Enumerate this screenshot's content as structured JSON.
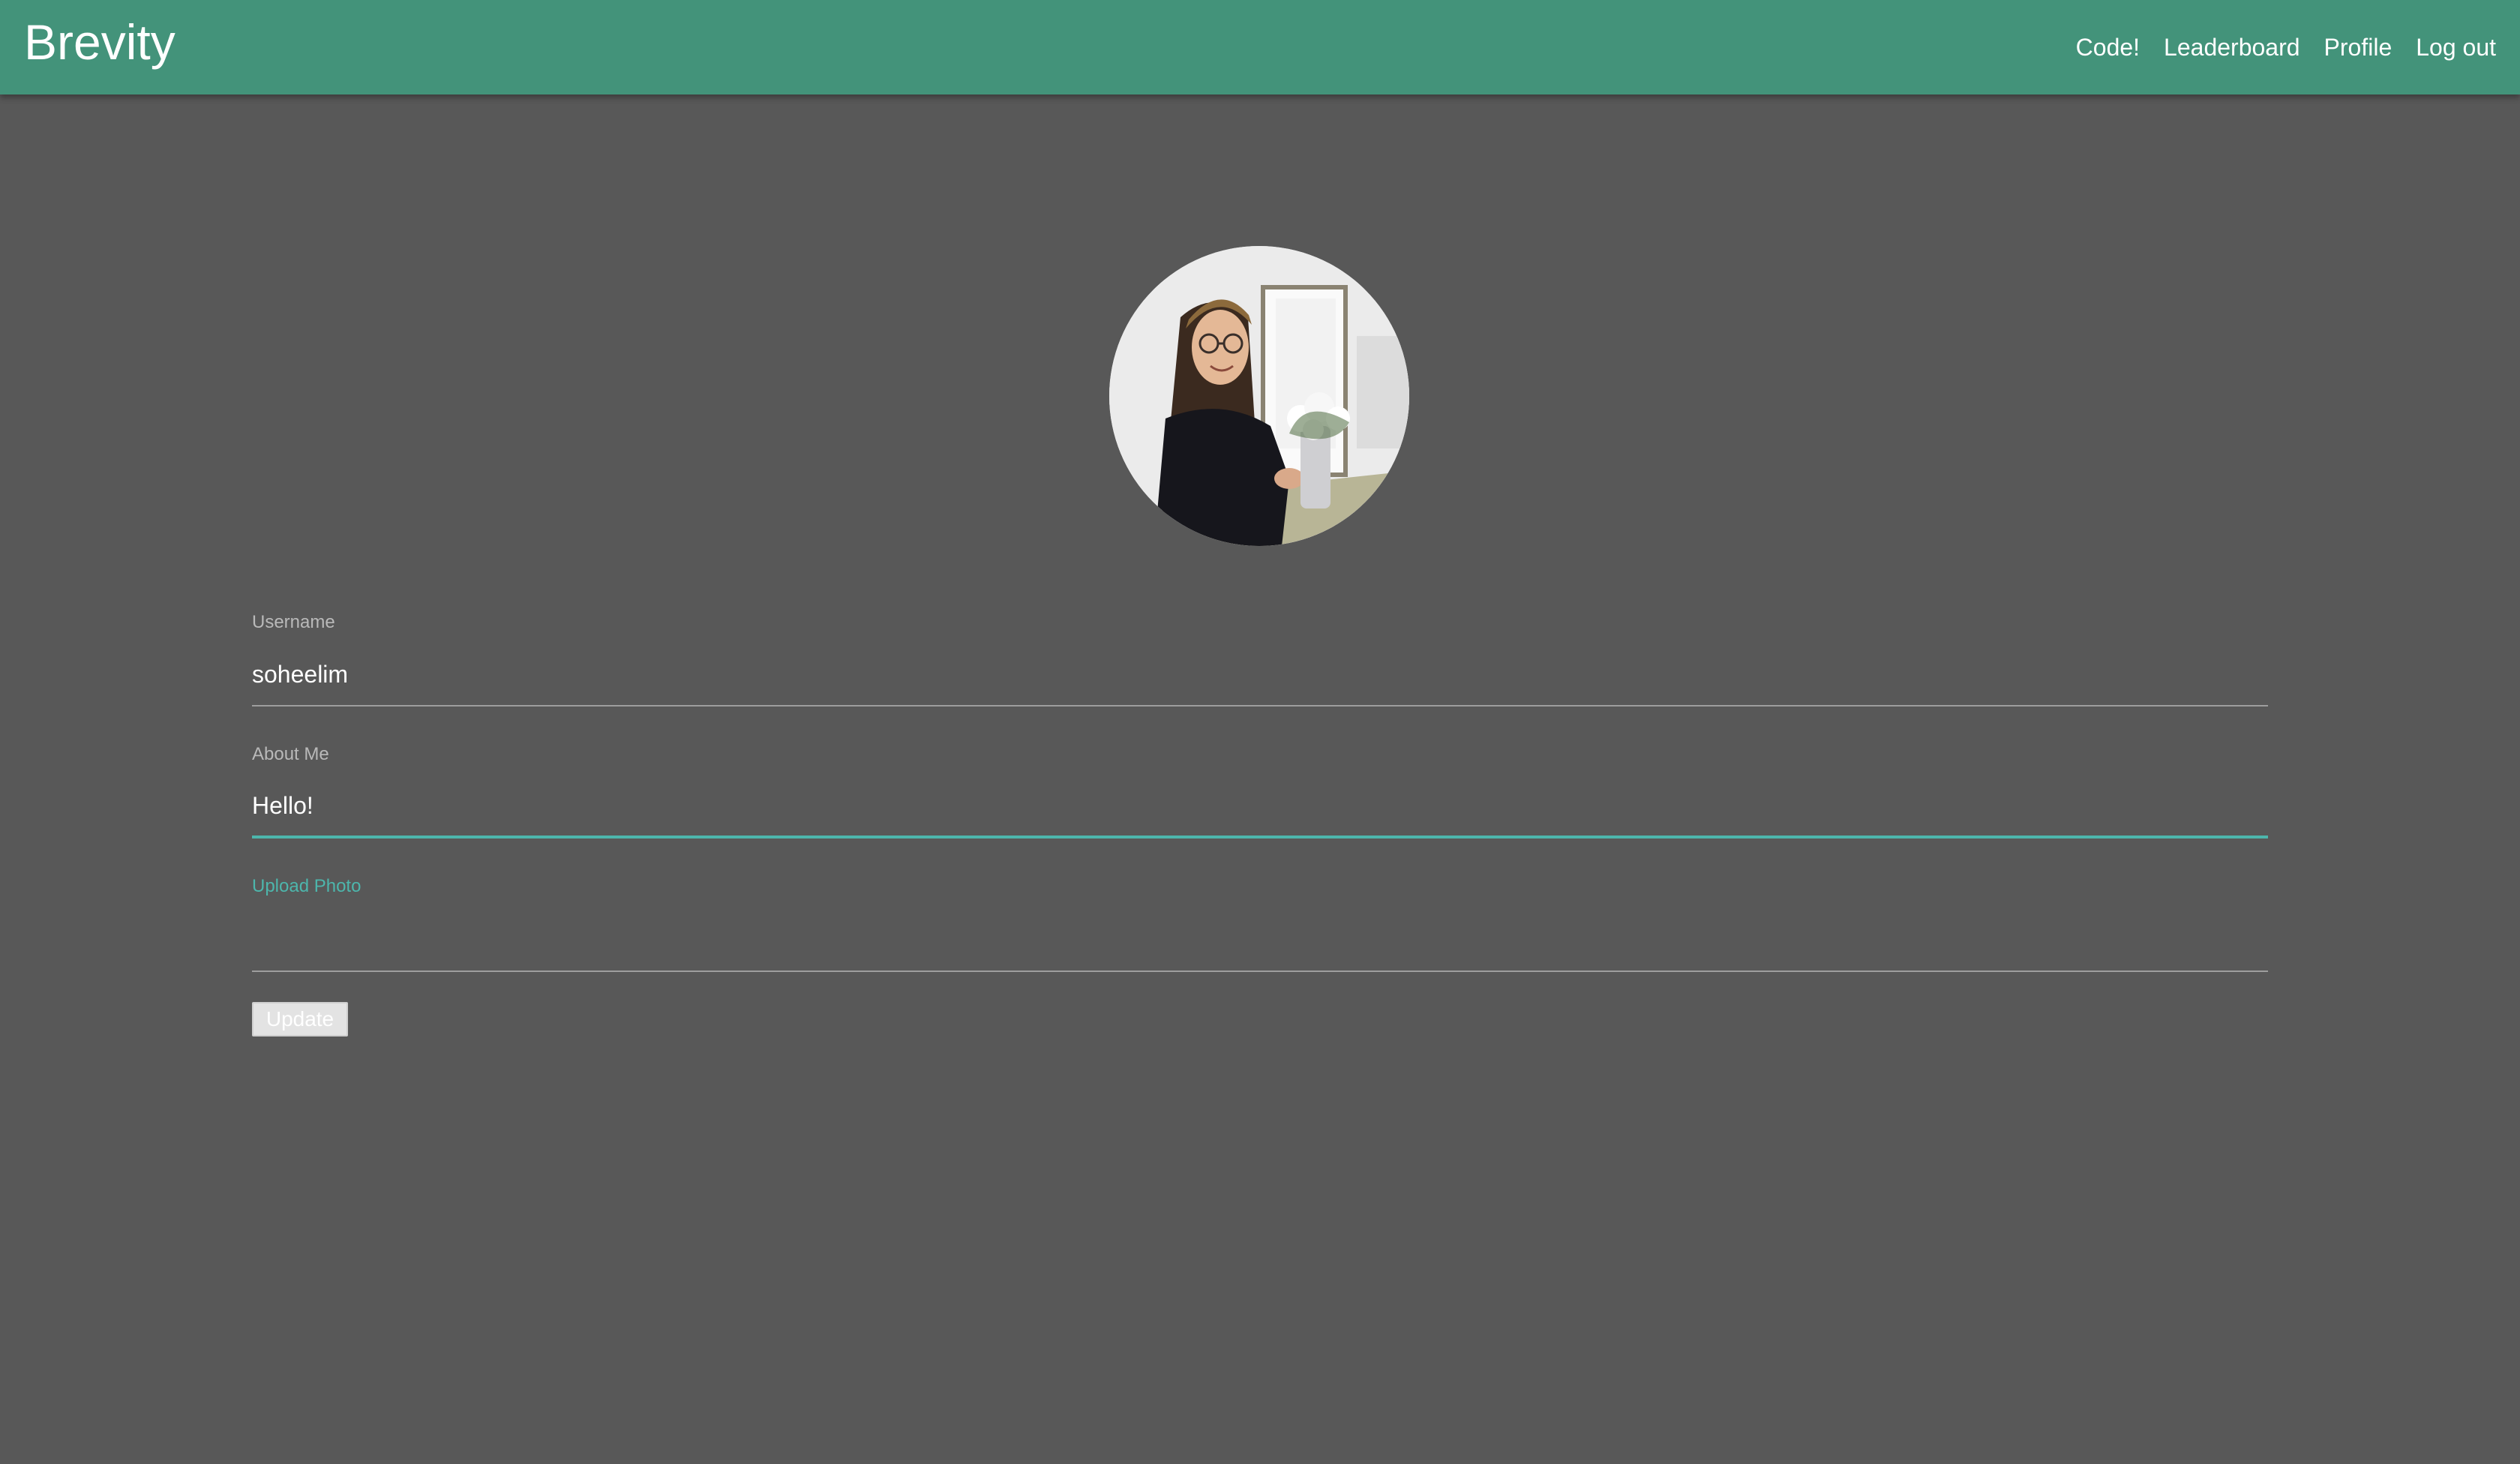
{
  "navbar": {
    "brand": "Brevity",
    "links": [
      {
        "label": "Code!"
      },
      {
        "label": "Leaderboard"
      },
      {
        "label": "Profile"
      },
      {
        "label": "Log out"
      }
    ]
  },
  "profile": {
    "avatar_icon": "user-photo",
    "username": {
      "label": "Username",
      "value": "soheelim"
    },
    "about": {
      "label": "About Me",
      "value": "Hello!"
    },
    "upload": {
      "label": "Upload Photo"
    },
    "update_label": "Update"
  },
  "colors": {
    "navbar": "#43937a",
    "background": "#585858",
    "accent": "#4db6ac"
  }
}
